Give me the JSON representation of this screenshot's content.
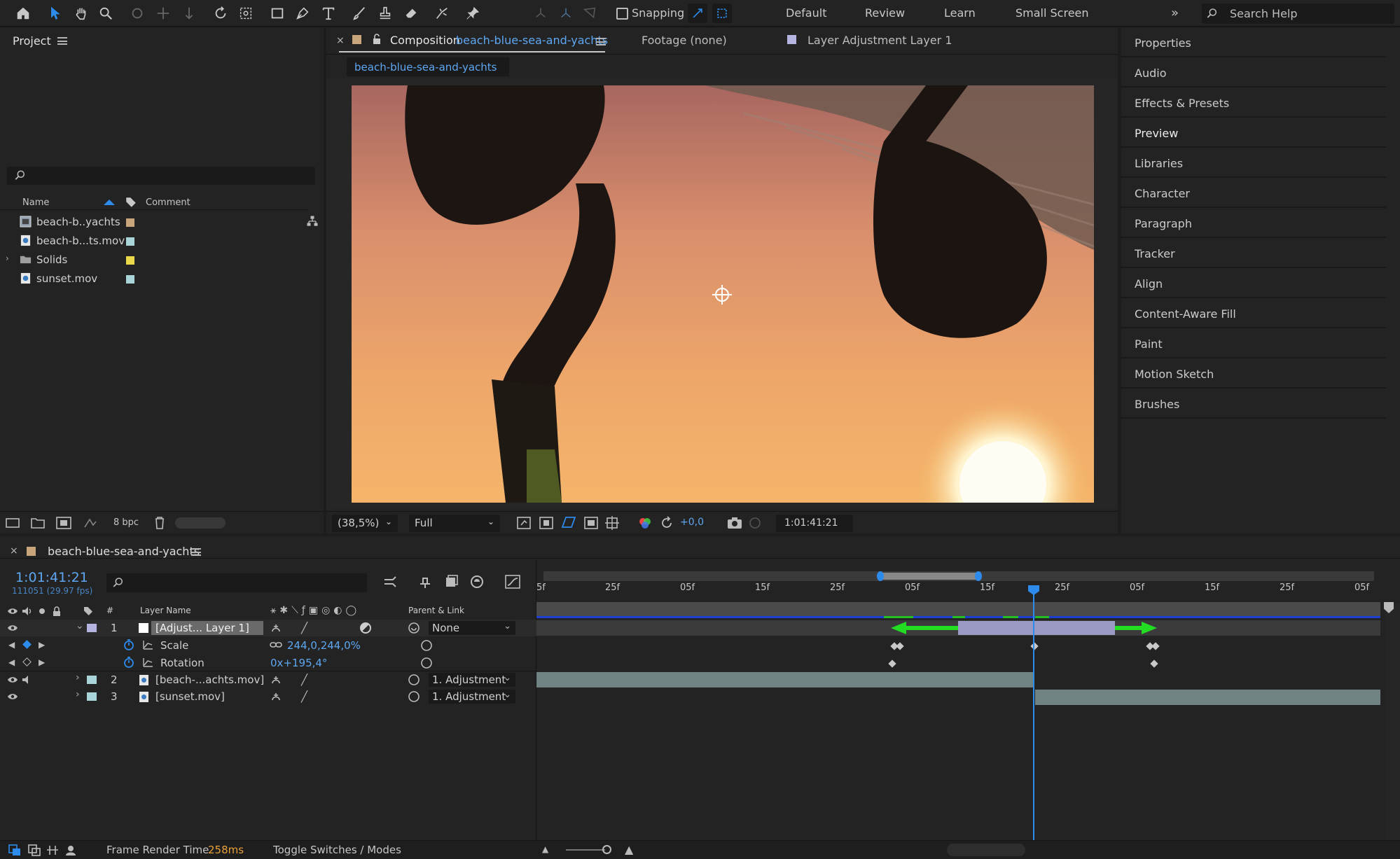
{
  "toolbar": {
    "snapping_label": "Snapping",
    "workspaces": [
      "Default",
      "Review",
      "Learn",
      "Small Screen"
    ],
    "search_placeholder": "Search Help",
    "accent_color": "#2d8ceb"
  },
  "project": {
    "title": "Project",
    "columns": {
      "name": "Name",
      "comment": "Comment"
    },
    "items": [
      {
        "label": "beach-b..yachts",
        "icon": "composition-icon",
        "color": "#c8a57a"
      },
      {
        "label": "beach-b...ts.mov",
        "icon": "footage-icon",
        "color": "#a9d5d8"
      },
      {
        "label": "Solids",
        "icon": "folder-icon",
        "color": "#e8d84a"
      },
      {
        "label": "sunset.mov",
        "icon": "footage-icon",
        "color": "#a9d5d8"
      }
    ],
    "bpc_label": "8 bpc"
  },
  "composition": {
    "tab_prefix": "Composition",
    "tab_name": "beach-blue-sea-and-yachts",
    "footage_tab": "Footage (none)",
    "layer_tab": "Layer Adjustment Layer 1",
    "subtab": "beach-blue-sea-and-yachts",
    "zoom": "(38,5%)",
    "resolution": "Full",
    "exposure": "+0,0",
    "timecode": "1:01:41:21"
  },
  "right_panels": {
    "items": [
      "Properties",
      "Audio",
      "Effects & Presets",
      "Preview",
      "Libraries",
      "Character",
      "Paragraph",
      "Tracker",
      "Align",
      "Content-Aware Fill",
      "Paint",
      "Motion Sketch",
      "Brushes"
    ]
  },
  "timeline": {
    "tab_name": "beach-blue-sea-and-yachts",
    "timecode": "1:01:41:21",
    "frame_info": "111051 (29.97 fps)",
    "columns": {
      "num": "#",
      "layer_name": "Layer Name",
      "parent": "Parent & Link"
    },
    "ruler_ticks": [
      "5f",
      "25f",
      "05f",
      "15f",
      "25f",
      "05f",
      "15f",
      "25f",
      "05f",
      "15f",
      "25f",
      "05f"
    ],
    "layers": [
      {
        "num": "1",
        "name": "[Adjust... Layer 1]",
        "parent": "None",
        "color": "#b5b3e0"
      },
      {
        "num": "2",
        "name": "[beach-...achts.mov]",
        "parent": "1. Adjustment",
        "color": "#a9d5d8"
      },
      {
        "num": "3",
        "name": "[sunset.mov]",
        "parent": "1. Adjustment",
        "color": "#a9d5d8"
      }
    ],
    "properties": [
      {
        "name": "Scale",
        "value": "244,0,244,0%"
      },
      {
        "name": "Rotation",
        "value": "0x+195,4°"
      }
    ]
  },
  "status": {
    "render_label": "Frame Render Time",
    "render_value": "258ms",
    "toggle_label": "Toggle Switches / Modes"
  }
}
